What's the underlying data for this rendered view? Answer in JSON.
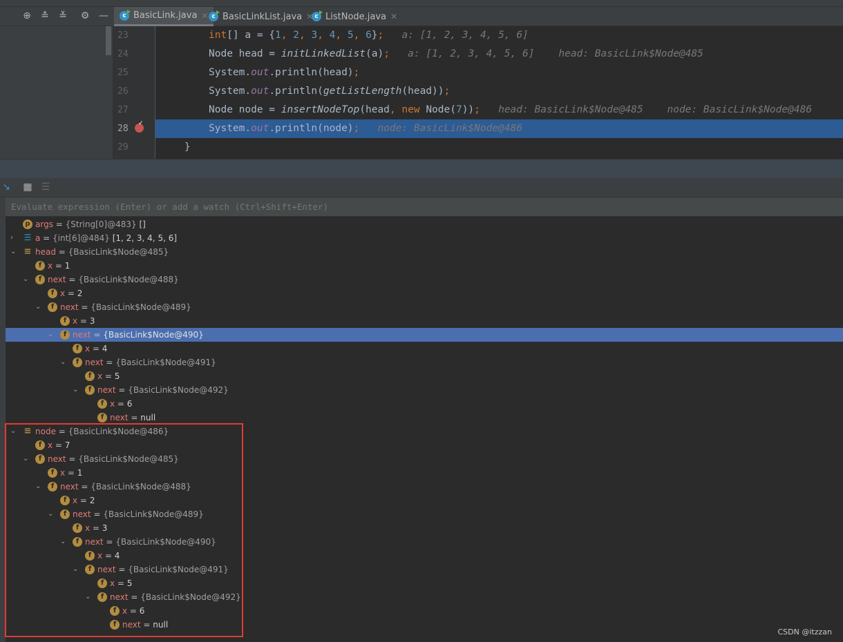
{
  "tabs": [
    {
      "label": "BasicLink.java",
      "active": true
    },
    {
      "label": "BasicLinkList.java"
    },
    {
      "label": "ListNode.java"
    }
  ],
  "toolbar_icons": [
    "crosshair-icon",
    "expand-all-icon",
    "collapse-all-icon",
    "gear-icon",
    "minimize-icon"
  ],
  "code_lines": [
    {
      "num": "23",
      "tokens": [
        [
          "int",
          "kw"
        ],
        [
          "[] a = {",
          "pl"
        ],
        [
          "1",
          "num"
        ],
        [
          ", ",
          "semi"
        ],
        [
          "2",
          "num"
        ],
        [
          ", ",
          "semi"
        ],
        [
          "3",
          "num"
        ],
        [
          ", ",
          "semi"
        ],
        [
          "4",
          "num"
        ],
        [
          ", ",
          "semi"
        ],
        [
          "5",
          "num"
        ],
        [
          ", ",
          "semi"
        ],
        [
          "6",
          "num"
        ],
        [
          "}",
          "pl"
        ],
        [
          ";",
          "semi"
        ],
        [
          "   a: [1, 2, 3, 4, 5, 6]",
          "hint"
        ]
      ]
    },
    {
      "num": "24",
      "tokens": [
        [
          "Node head = ",
          "pl"
        ],
        [
          "initLinkedList",
          "fn"
        ],
        [
          "(a)",
          "pl"
        ],
        [
          ";",
          "semi"
        ],
        [
          "   a: [1, 2, 3, 4, 5, 6]    head: BasicLink$Node@485",
          "hint"
        ]
      ]
    },
    {
      "num": "25",
      "tokens": [
        [
          "System.",
          "pl"
        ],
        [
          "out",
          "st"
        ],
        [
          ".println(head)",
          "pl"
        ],
        [
          ";",
          "semi"
        ]
      ]
    },
    {
      "num": "26",
      "tokens": [
        [
          "System.",
          "pl"
        ],
        [
          "out",
          "st"
        ],
        [
          ".println(",
          "pl"
        ],
        [
          "getListLength",
          "fn"
        ],
        [
          "(head))",
          "pl"
        ],
        [
          ";",
          "semi"
        ]
      ]
    },
    {
      "num": "27",
      "tokens": [
        [
          "Node node = ",
          "pl"
        ],
        [
          "insertNodeTop",
          "fn"
        ],
        [
          "(head",
          "pl"
        ],
        [
          ", ",
          "semi"
        ],
        [
          "new ",
          "kw"
        ],
        [
          "Node(",
          "pl"
        ],
        [
          "7",
          "num"
        ],
        [
          "))",
          "pl"
        ],
        [
          ";",
          "semi"
        ],
        [
          "   head: BasicLink$Node@485    node: BasicLink$Node@486",
          "hint"
        ]
      ]
    },
    {
      "num": "28",
      "current": true,
      "tokens": [
        [
          "System.",
          "pl"
        ],
        [
          "out",
          "st"
        ],
        [
          ".println(node)",
          "pl"
        ],
        [
          ";",
          "semi"
        ],
        [
          "   node: BasicLink$Node@486",
          "hint"
        ]
      ]
    },
    {
      "num": "29",
      "tokens": [
        [
          "    }",
          "pl"
        ]
      ]
    }
  ],
  "eval_placeholder": "Evaluate expression (Enter) or add a watch (Ctrl+Shift+Enter)",
  "variables": [
    {
      "level": 0,
      "icon": "p",
      "name": "args",
      "value": "{String[0]@483}",
      "extra": "[]"
    },
    {
      "level": 0,
      "icon": "arr",
      "state": "collapsed",
      "name": "a",
      "value": "{int[6]@484}",
      "extra": "[1, 2, 3, 4, 5, 6]"
    },
    {
      "level": 0,
      "icon": "obj",
      "state": "expanded",
      "name": "head",
      "value": "{BasicLink$Node@485}"
    },
    {
      "level": 1,
      "icon": "f",
      "name": "x",
      "plain": "1"
    },
    {
      "level": 1,
      "icon": "f",
      "state": "expanded",
      "name": "next",
      "value": "{BasicLink$Node@488}"
    },
    {
      "level": 2,
      "icon": "f",
      "name": "x",
      "plain": "2"
    },
    {
      "level": 2,
      "icon": "f",
      "state": "expanded",
      "name": "next",
      "value": "{BasicLink$Node@489}"
    },
    {
      "level": 3,
      "icon": "f",
      "name": "x",
      "plain": "3"
    },
    {
      "level": 3,
      "icon": "f",
      "state": "expanded",
      "name": "next",
      "value": "{BasicLink$Node@490}",
      "selected": true
    },
    {
      "level": 4,
      "icon": "f",
      "name": "x",
      "plain": "4"
    },
    {
      "level": 4,
      "icon": "f",
      "state": "expanded",
      "name": "next",
      "value": "{BasicLink$Node@491}"
    },
    {
      "level": 5,
      "icon": "f",
      "name": "x",
      "plain": "5"
    },
    {
      "level": 5,
      "icon": "f",
      "state": "expanded",
      "name": "next",
      "value": "{BasicLink$Node@492}"
    },
    {
      "level": 6,
      "icon": "f",
      "name": "x",
      "plain": "6"
    },
    {
      "level": 6,
      "icon": "f",
      "name": "next",
      "plain": "null"
    },
    {
      "level": 0,
      "icon": "obj",
      "state": "expanded",
      "name": "node",
      "value": "{BasicLink$Node@486}"
    },
    {
      "level": 1,
      "icon": "f",
      "name": "x",
      "plain": "7"
    },
    {
      "level": 1,
      "icon": "f",
      "state": "expanded",
      "name": "next",
      "value": "{BasicLink$Node@485}"
    },
    {
      "level": 2,
      "icon": "f",
      "name": "x",
      "plain": "1"
    },
    {
      "level": 2,
      "icon": "f",
      "state": "expanded",
      "name": "next",
      "value": "{BasicLink$Node@488}"
    },
    {
      "level": 3,
      "icon": "f",
      "name": "x",
      "plain": "2"
    },
    {
      "level": 3,
      "icon": "f",
      "state": "expanded",
      "name": "next",
      "value": "{BasicLink$Node@489}"
    },
    {
      "level": 4,
      "icon": "f",
      "name": "x",
      "plain": "3"
    },
    {
      "level": 4,
      "icon": "f",
      "state": "expanded",
      "name": "next",
      "value": "{BasicLink$Node@490}"
    },
    {
      "level": 5,
      "icon": "f",
      "name": "x",
      "plain": "4"
    },
    {
      "level": 5,
      "icon": "f",
      "state": "expanded",
      "name": "next",
      "value": "{BasicLink$Node@491}"
    },
    {
      "level": 6,
      "icon": "f",
      "name": "x",
      "plain": "5"
    },
    {
      "level": 6,
      "icon": "f",
      "state": "expanded",
      "name": "next",
      "value": "{BasicLink$Node@492}"
    },
    {
      "level": 7,
      "icon": "f",
      "name": "x",
      "plain": "6"
    },
    {
      "level": 7,
      "icon": "f",
      "name": "next",
      "plain": "null"
    }
  ],
  "highlight_color": "#e53935",
  "watermark": "CSDN @itzzan"
}
